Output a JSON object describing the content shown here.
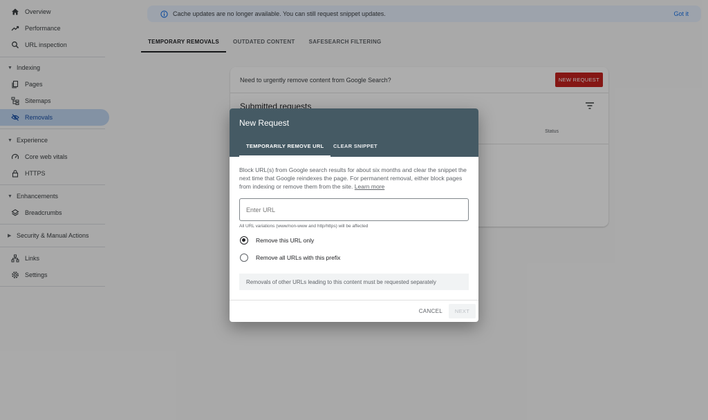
{
  "sidebar": {
    "items": [
      {
        "label": "Overview",
        "icon": "home-icon"
      },
      {
        "label": "Performance",
        "icon": "trending-up-icon"
      },
      {
        "label": "URL inspection",
        "icon": "search-icon"
      }
    ],
    "indexing": {
      "title": "Indexing",
      "items": [
        {
          "label": "Pages",
          "icon": "pages-icon"
        },
        {
          "label": "Sitemaps",
          "icon": "sitemap-icon"
        },
        {
          "label": "Removals",
          "icon": "eye-off-icon"
        }
      ]
    },
    "experience": {
      "title": "Experience",
      "items": [
        {
          "label": "Core web vitals",
          "icon": "gauge-icon"
        },
        {
          "label": "HTTPS",
          "icon": "lock-icon"
        }
      ]
    },
    "enhancements": {
      "title": "Enhancements",
      "items": [
        {
          "label": "Breadcrumbs",
          "icon": "layers-icon"
        }
      ]
    },
    "security": {
      "title": "Security & Manual Actions"
    },
    "bottom": [
      {
        "label": "Links",
        "icon": "links-icon"
      },
      {
        "label": "Settings",
        "icon": "gear-icon"
      }
    ]
  },
  "banner": {
    "text": "Cache updates are no longer available. You can still request snippet updates.",
    "action": "Got it"
  },
  "tabs": [
    "TEMPORARY REMOVALS",
    "OUTDATED CONTENT",
    "SAFESEARCH FILTERING"
  ],
  "card": {
    "prompt": "Need to urgently remove content from Google Search?",
    "new_request": "NEW REQUEST",
    "subtitle": "Submitted requests",
    "status_col": "Status"
  },
  "dialog": {
    "title": "New Request",
    "tabs": [
      "TEMPORARILY REMOVE URL",
      "CLEAR SNIPPET"
    ],
    "description": "Block URL(s) from Google search results for about six months and clear the snippet the next time that Google reindexes the page. For permanent removal, either block pages from indexing or remove them from the site.",
    "learn_more": "Learn more",
    "url_placeholder": "Enter URL",
    "url_hint": "All URL variations (www/non-www and http/https) will be affected",
    "options": [
      "Remove this URL only",
      "Remove all URLs with this prefix"
    ],
    "note": "Removals of other URLs leading to this content must be requested separately",
    "cancel": "CANCEL",
    "next": "NEXT"
  }
}
